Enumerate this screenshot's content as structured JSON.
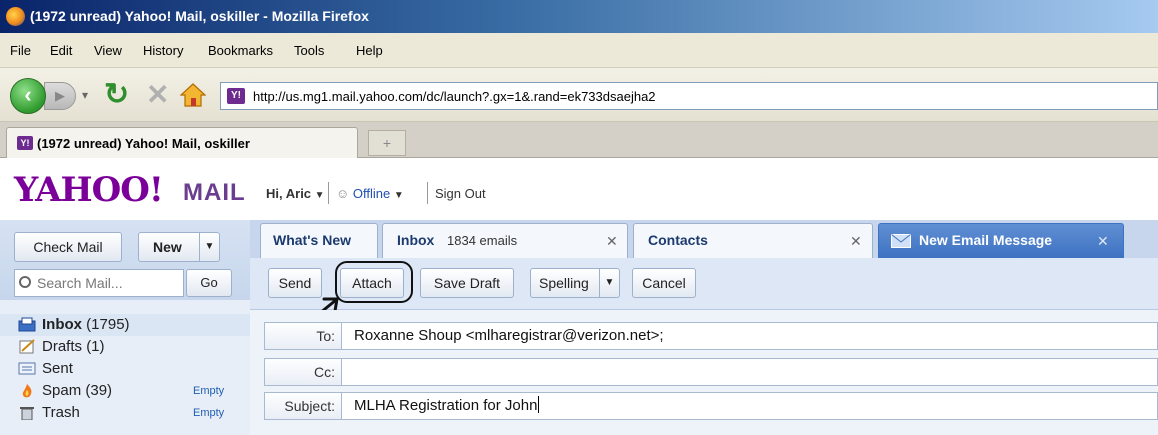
{
  "window": {
    "title": "(1972 unread) Yahoo! Mail, oskiller - Mozilla Firefox"
  },
  "menu": [
    "File",
    "Edit",
    "View",
    "History",
    "Bookmarks",
    "Tools",
    "Help"
  ],
  "nav": {
    "url": "http://us.mg1.mail.yahoo.com/dc/launch?.gx=1&.rand=ek733dsaejha2"
  },
  "browser_tab": {
    "label": "(1972 unread) Yahoo! Mail, oskiller",
    "new_tab_glyph": "+"
  },
  "header": {
    "logo": "YAHOO!",
    "logo_suffix": "MAIL",
    "greeting": "Hi, Aric",
    "status": "Offline",
    "sign_out": "Sign Out"
  },
  "sidebar": {
    "check_mail": "Check Mail",
    "new_label": "New",
    "search_placeholder": "Search Mail...",
    "go_label": "Go",
    "folders": [
      {
        "name": "Inbox",
        "count": "(1795)",
        "icon": "inbox-icon"
      },
      {
        "name": "Drafts",
        "count": "(1)",
        "icon": "drafts-icon"
      },
      {
        "name": "Sent",
        "count": "",
        "icon": "sent-icon"
      },
      {
        "name": "Spam",
        "count": "(39)",
        "icon": "spam-icon",
        "action": "Empty"
      },
      {
        "name": "Trash",
        "count": "",
        "icon": "trash-icon",
        "action": "Empty"
      }
    ]
  },
  "tabs": [
    {
      "label": "What's New"
    },
    {
      "label": "Inbox",
      "detail": "1834 emails"
    },
    {
      "label": "Contacts"
    },
    {
      "label": "New Email Message"
    }
  ],
  "toolbar": {
    "send": "Send",
    "attach": "Attach",
    "save_draft": "Save Draft",
    "spelling": "Spelling",
    "cancel": "Cancel"
  },
  "compose": {
    "to_label": "To:",
    "to_value": "Roxanne Shoup <mlharegistrar@verizon.net>;",
    "cc_label": "Cc:",
    "cc_value": "",
    "subject_label": "Subject:",
    "subject_value": "MLHA Registration for John"
  },
  "colors": {
    "yahoo_purple": "#7b0099",
    "active_tab": "#3e72c2",
    "link_blue": "#1f5fb0"
  }
}
